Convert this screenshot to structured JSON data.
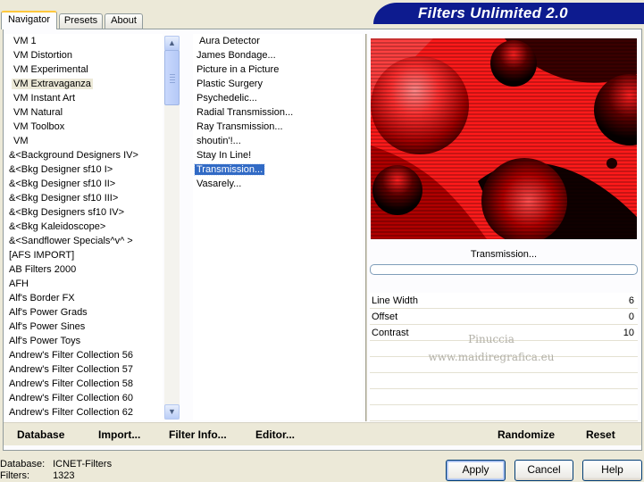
{
  "tabs": [
    {
      "label": "Navigator",
      "active": true
    },
    {
      "label": "Presets",
      "active": false
    },
    {
      "label": "About",
      "active": false
    }
  ],
  "brand": {
    "title": "Filters Unlimited 2.0",
    "color": "#0d1b8f"
  },
  "categories": [
    {
      "label": "VM 1",
      "indent": true
    },
    {
      "label": "VM Distortion",
      "indent": true
    },
    {
      "label": "VM Experimental",
      "indent": true
    },
    {
      "label": "VM Extravaganza",
      "indent": true,
      "selected": true
    },
    {
      "label": "VM Instant Art",
      "indent": true
    },
    {
      "label": "VM Natural",
      "indent": true
    },
    {
      "label": "VM Toolbox",
      "indent": true
    },
    {
      "label": "VM",
      "indent": true
    },
    {
      "label": "&<Background Designers IV>"
    },
    {
      "label": "&<Bkg Designer sf10 I>"
    },
    {
      "label": "&<Bkg Designer sf10 II>"
    },
    {
      "label": "&<Bkg Designer sf10 III>"
    },
    {
      "label": "&<Bkg Designers sf10 IV>"
    },
    {
      "label": "&<Bkg Kaleidoscope>"
    },
    {
      "label": "&<Sandflower Specials^v^ >"
    },
    {
      "label": "[AFS IMPORT]"
    },
    {
      "label": "AB Filters 2000"
    },
    {
      "label": "AFH"
    },
    {
      "label": "Alf's Border FX"
    },
    {
      "label": "Alf's Power Grads"
    },
    {
      "label": "Alf's Power Sines"
    },
    {
      "label": "Alf's Power Toys"
    },
    {
      "label": "Andrew's Filter Collection 56"
    },
    {
      "label": "Andrew's Filter Collection 57"
    },
    {
      "label": "Andrew's Filter Collection 58"
    },
    {
      "label": "Andrew's Filter Collection 60"
    },
    {
      "label": "Andrew's Filter Collection 62"
    }
  ],
  "filters": [
    {
      "label": "Aura Detector",
      "offset": true
    },
    {
      "label": "James Bondage..."
    },
    {
      "label": "Picture in a Picture"
    },
    {
      "label": "Plastic Surgery"
    },
    {
      "label": "Psychedelic..."
    },
    {
      "label": "Radial Transmission..."
    },
    {
      "label": "Ray Transmission..."
    },
    {
      "label": "shoutin'!..."
    },
    {
      "label": "Stay In Line!"
    },
    {
      "label": "Transmission...",
      "selected": true
    },
    {
      "label": "Vasarely..."
    }
  ],
  "preview": {
    "filter_name": "Transmission...",
    "accent_red": "#ff2020"
  },
  "params": [
    {
      "name": "Line Width",
      "value": "6"
    },
    {
      "name": "Offset",
      "value": "0"
    },
    {
      "name": "Contrast",
      "value": "10"
    },
    {
      "name": "",
      "value": ""
    },
    {
      "name": "",
      "value": ""
    },
    {
      "name": "",
      "value": ""
    },
    {
      "name": "",
      "value": ""
    },
    {
      "name": "",
      "value": ""
    }
  ],
  "watermark": {
    "line1": "Pinuccia",
    "line2": "www.maidiregrafica.eu"
  },
  "toolbar": {
    "database": "Database",
    "import": "Import...",
    "filter_info": "Filter Info...",
    "editor": "Editor...",
    "randomize": "Randomize",
    "reset": "Reset"
  },
  "status": {
    "database_label": "Database:",
    "database_value": "ICNET-Filters",
    "filters_label": "Filters:",
    "filters_value": "1323"
  },
  "buttons": {
    "apply": "Apply",
    "cancel": "Cancel",
    "help": "Help"
  },
  "icons": {
    "scroll_up": "chevron-up-icon",
    "scroll_down": "chevron-down-icon"
  }
}
